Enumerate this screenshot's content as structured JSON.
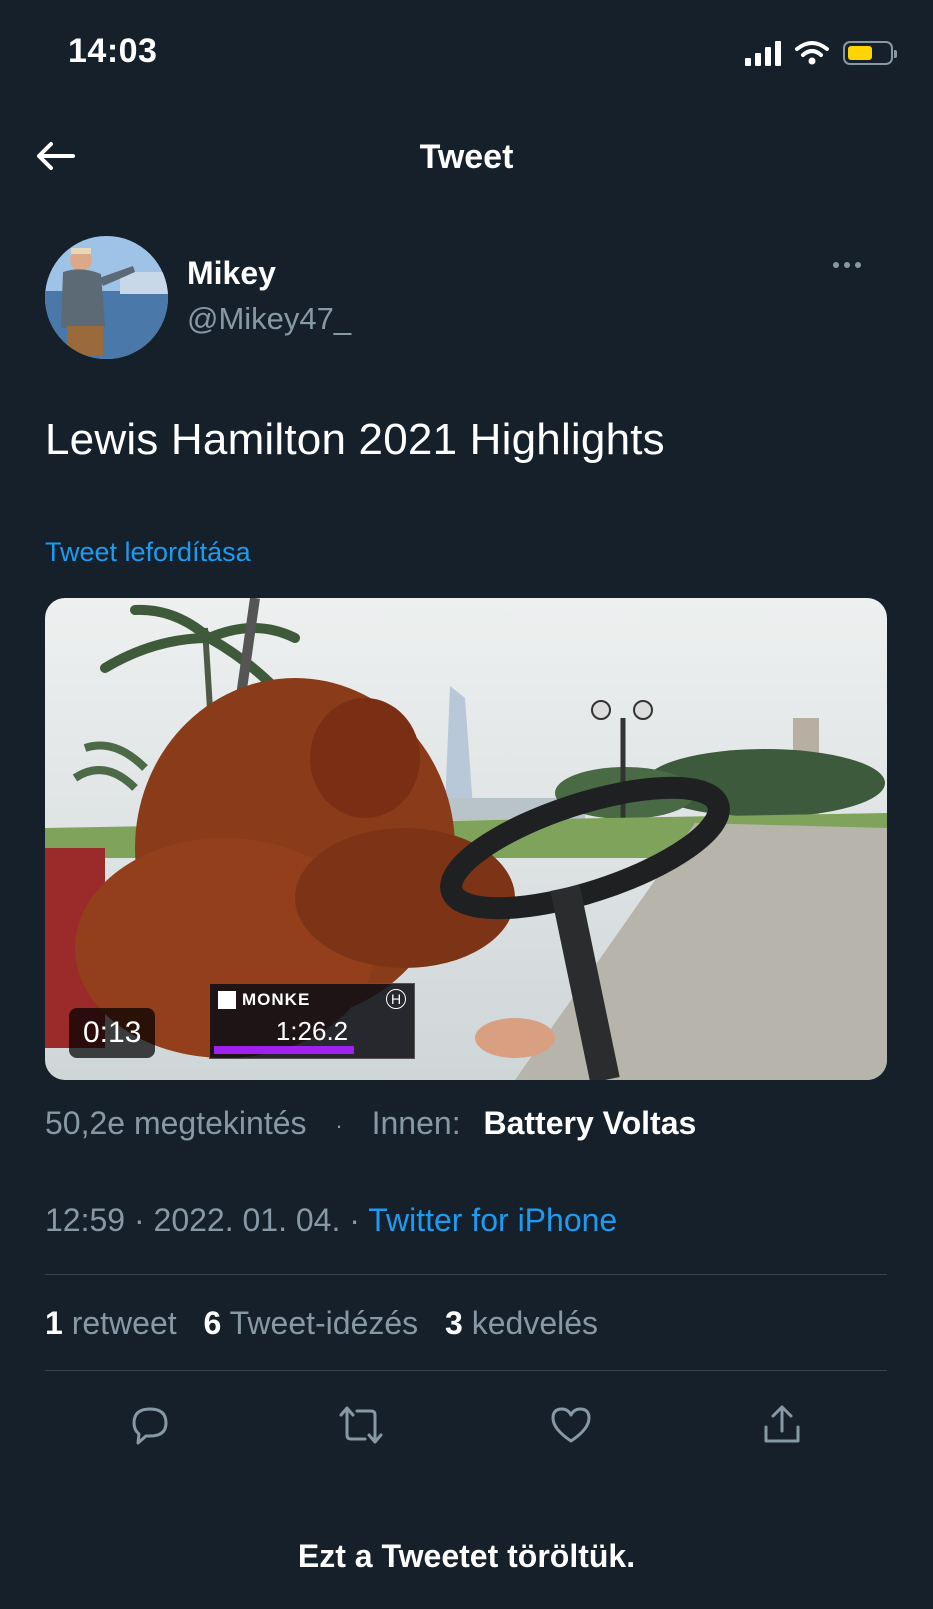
{
  "status_bar": {
    "time": "14:03",
    "battery_level": 0.6,
    "battery_color": "#ffd400"
  },
  "header": {
    "back_icon": "arrow-left-icon",
    "title": "Tweet"
  },
  "author": {
    "name": "Mikey",
    "handle": "@Mikey47_",
    "more_icon": "more-horizontal-icon"
  },
  "tweet": {
    "text": "Lewis Hamilton 2021 Highlights",
    "translate_label": "Tweet lefordítása"
  },
  "media": {
    "duration": "0:13",
    "overlay_name": "Monke",
    "overlay_team": "H",
    "overlay_time": "1:26.2"
  },
  "meta": {
    "views": "50,2e megtekintés",
    "separator": "·",
    "source_label": "Innen:",
    "source_name": "Battery Voltas",
    "time": "12:59 · 2022. 01. 04. ·",
    "client": "Twitter for iPhone"
  },
  "stats": {
    "retweets_count": "1",
    "retweets_label": "retweet",
    "quotes_count": "6",
    "quotes_label": "Tweet-idézés",
    "likes_count": "3",
    "likes_label": "kedvelés"
  },
  "actions": [
    "reply-icon",
    "retweet-icon",
    "like-icon",
    "share-icon"
  ],
  "footer": {
    "deleted_text": "Ezt a Tweetet töröltük."
  },
  "colors": {
    "background": "#15202b",
    "accent": "#1d9bf0",
    "muted": "#8899a6",
    "divider": "#38444d"
  }
}
